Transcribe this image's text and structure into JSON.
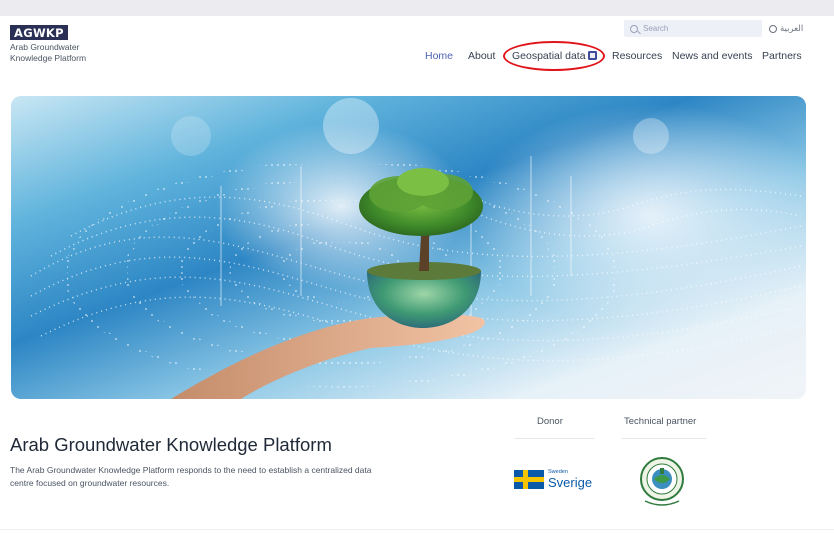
{
  "header": {
    "logo_badge": "AGWKP",
    "logo_line1": "Arab Groundwater",
    "logo_line2": "Knowledge Platform",
    "search_placeholder": "Search",
    "language_label": "العربية",
    "language_icon": "globe-icon"
  },
  "nav": {
    "items": [
      {
        "label": "Home",
        "active": true
      },
      {
        "label": "About",
        "active": false
      },
      {
        "label": "Geospatial data",
        "active": false,
        "icon": "map-icon",
        "highlighted": true
      },
      {
        "label": "Resources",
        "active": false
      },
      {
        "label": "News and events",
        "active": false
      },
      {
        "label": "Partners",
        "active": false
      }
    ]
  },
  "hero": {
    "image": "hand-holding-tree-and-globe"
  },
  "intro": {
    "title": "Arab Groundwater Knowledge Platform",
    "description": "The Arab Groundwater Knowledge Platform responds to the need to establish a centralized data centre focused on groundwater resources."
  },
  "sponsors": {
    "donor_label": "Donor",
    "partner_label": "Technical partner",
    "donor_logo_small": "Sweden",
    "donor_logo_big": "Sverige",
    "partner_logo": "acsad-seal-logo"
  },
  "colors": {
    "brand": "#2a2f55",
    "nav_active": "#4f63b8",
    "highlight": "#e0141a",
    "sweden_blue": "#0b5aa7",
    "sweden_yellow": "#f5c400"
  }
}
